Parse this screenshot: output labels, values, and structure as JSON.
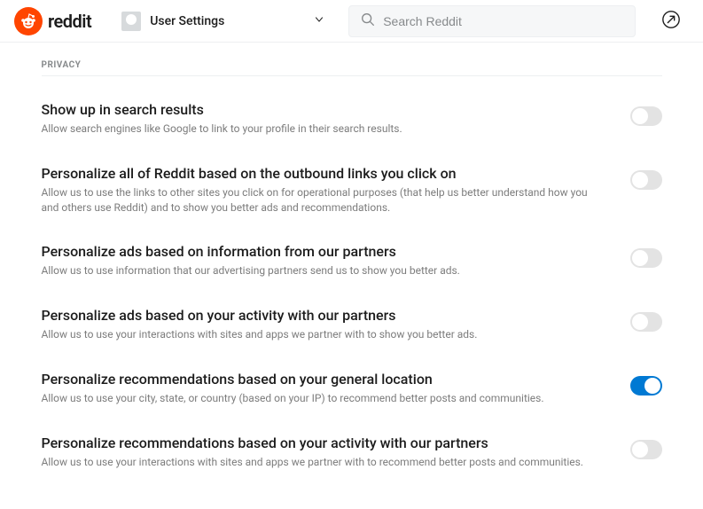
{
  "header": {
    "logo_text": "reddit",
    "nav_label": "User Settings",
    "search_placeholder": "Search Reddit"
  },
  "section_heading": "PRIVACY",
  "settings": [
    {
      "title": "Show up in search results",
      "desc": "Allow search engines like Google to link to your profile in their search results.",
      "on": false
    },
    {
      "title": "Personalize all of Reddit based on the outbound links you click on",
      "desc": "Allow us to use the links to other sites you click on for operational purposes (that help us better understand how you and others use Reddit) and to show you better ads and recommendations.",
      "on": false
    },
    {
      "title": "Personalize ads based on information from our partners",
      "desc": "Allow us to use information that our advertising partners send us to show you better ads.",
      "on": false
    },
    {
      "title": "Personalize ads based on your activity with our partners",
      "desc": "Allow us to use your interactions with sites and apps we partner with to show you better ads.",
      "on": false
    },
    {
      "title": "Personalize recommendations based on your general location",
      "desc": "Allow us to use your city, state, or country (based on your IP) to recommend better posts and communities.",
      "on": true
    },
    {
      "title": "Personalize recommendations based on your activity with our partners",
      "desc": "Allow us to use your interactions with sites and apps we partner with to recommend better posts and communities.",
      "on": false
    }
  ]
}
